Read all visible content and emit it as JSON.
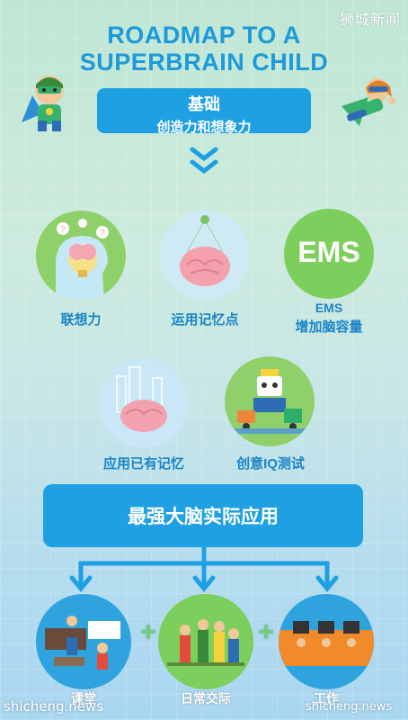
{
  "watermark_top": "狮城新闻",
  "title_line1": "ROADMAP TO A",
  "title_line2": "SUPERBRAIN CHILD",
  "hero": {
    "line1": "基础",
    "line2": "创造力和想象力"
  },
  "skills": [
    {
      "label": "联想力"
    },
    {
      "label": "运用记忆点"
    },
    {
      "label_line1": "EMS",
      "label_line2": "增加脑容量",
      "badge": "EMS"
    },
    {
      "label": "应用已有记忆"
    },
    {
      "label": "创意IQ测试"
    }
  ],
  "application_box": "最强大脑实际应用",
  "outcomes": [
    {
      "label": "课堂"
    },
    {
      "label": "日常交际"
    },
    {
      "label": "工作"
    }
  ],
  "plus": "+",
  "watermark_bottom_left": "shicheng.news",
  "watermark_bottom_right": "shicheng.news",
  "colors": {
    "accent": "#1ea0e2",
    "title": "#1d9ad9",
    "label": "#1a84c6"
  }
}
